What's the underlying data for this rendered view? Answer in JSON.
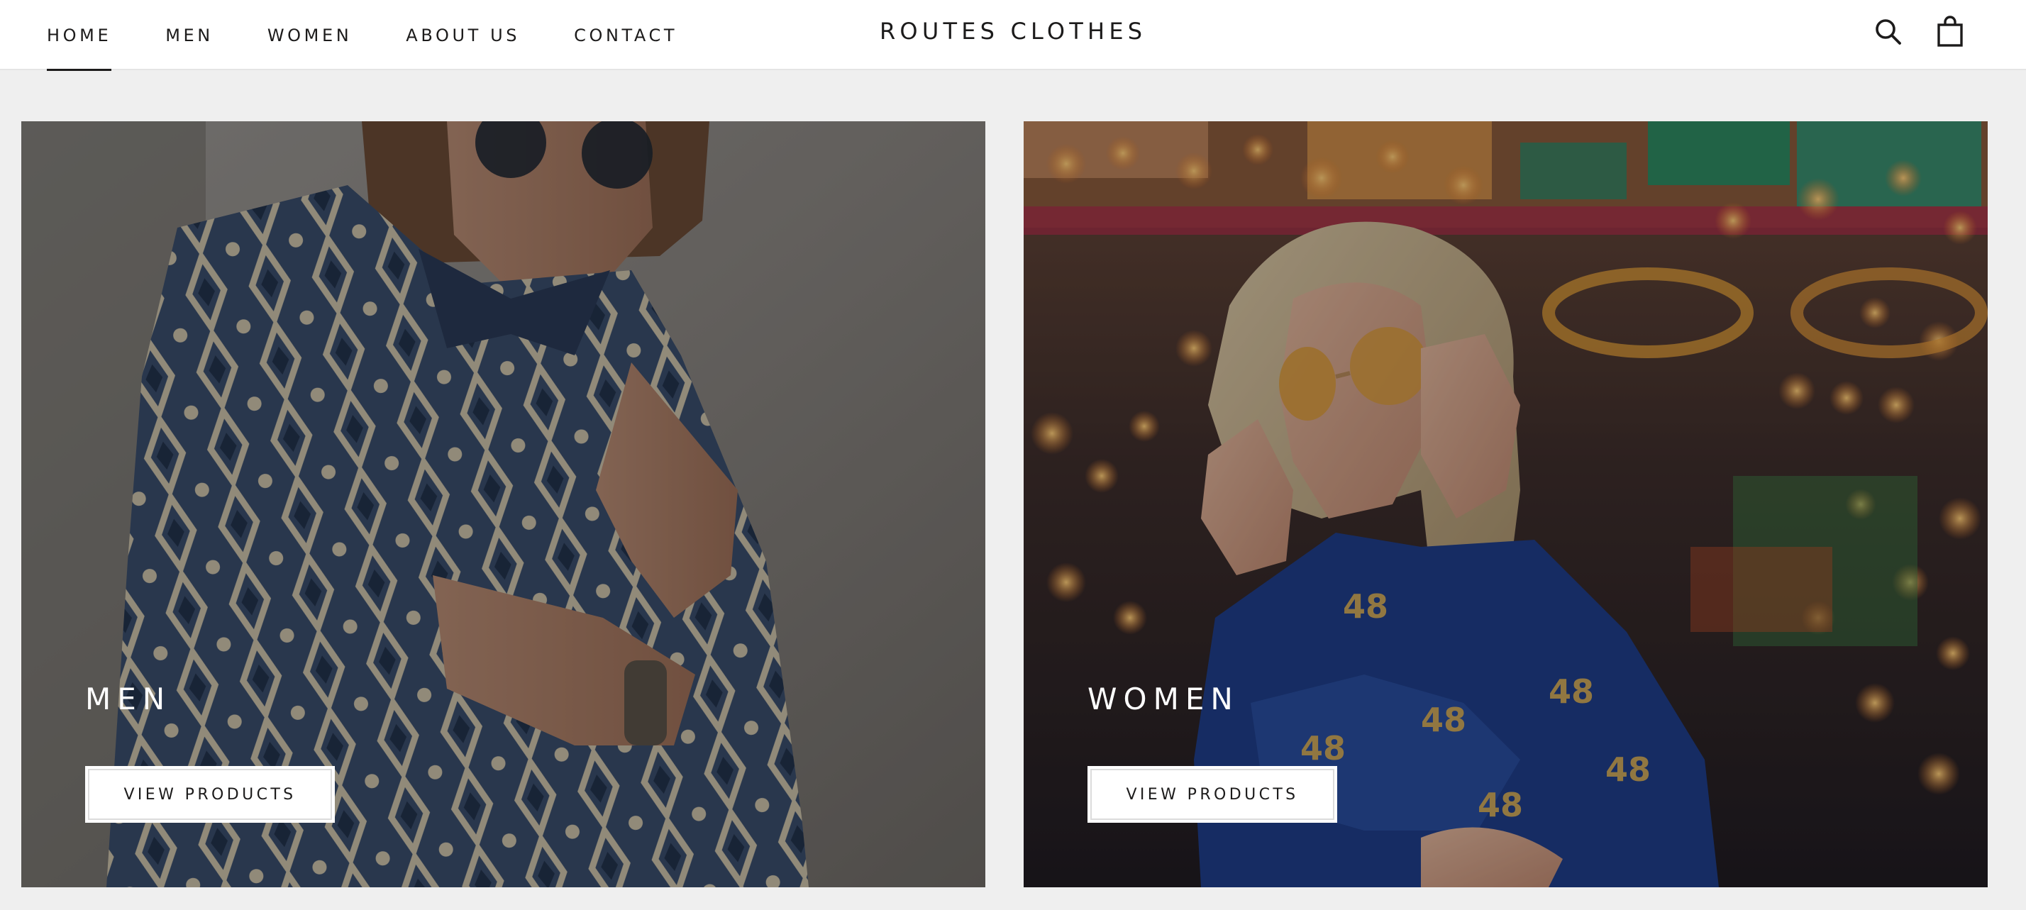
{
  "header": {
    "nav": [
      {
        "label": "HOME",
        "active": true
      },
      {
        "label": "MEN",
        "active": false
      },
      {
        "label": "WOMEN",
        "active": false
      },
      {
        "label": "ABOUT US",
        "active": false
      },
      {
        "label": "CONTACT",
        "active": false
      }
    ],
    "brand": "ROUTES CLOTHES",
    "icons": {
      "search": "search-icon",
      "cart": "shopping-bag-icon"
    }
  },
  "collections": [
    {
      "title": "MEN",
      "button_label": "VIEW PRODUCTS",
      "image": "man-in-patterned-blue-shirt-photo"
    },
    {
      "title": "WOMEN",
      "button_label": "VIEW PRODUCTS",
      "image": "woman-in-sunglasses-carnival-lights-photo"
    }
  ],
  "colors": {
    "text": "#1c1b1b",
    "page_background": "#efefef",
    "header_background": "#ffffff"
  }
}
